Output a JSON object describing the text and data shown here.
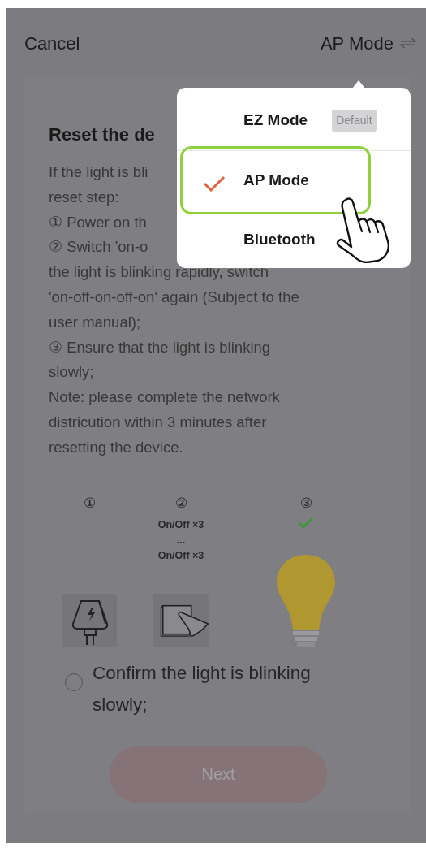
{
  "header": {
    "cancel": "Cancel",
    "mode": "AP Mode"
  },
  "instructions": {
    "title": "Reset the de",
    "lines": [
      "If the light is bli",
      "reset step:",
      "① Power on th",
      "② Switch 'on-o",
      "the light is blinking rapidly, switch",
      "'on-off-on-off-on' again (Subject to the",
      "user manual);",
      "③ Ensure that the light is blinking",
      "slowly;",
      "Note: please complete the network",
      "districution within 3 minutes after",
      "resetting the device."
    ]
  },
  "illustration": {
    "steps": [
      {
        "kind": "power",
        "number": "①"
      },
      {
        "kind": "switch",
        "number": "②",
        "captions": [
          "On/Off ×3",
          "...",
          "On/Off ×3"
        ]
      },
      {
        "kind": "bulb",
        "number": "③"
      }
    ]
  },
  "confirm": {
    "label": "Confirm the light is blinking slowly;",
    "checked": false
  },
  "next_button": {
    "label": "Next",
    "disabled": true
  },
  "mode_menu": {
    "items": [
      {
        "label": "EZ Mode",
        "badge": "Default",
        "selected": false
      },
      {
        "label": "AP Mode",
        "selected": true
      },
      {
        "label": "Bluetooth",
        "selected": false
      }
    ]
  }
}
